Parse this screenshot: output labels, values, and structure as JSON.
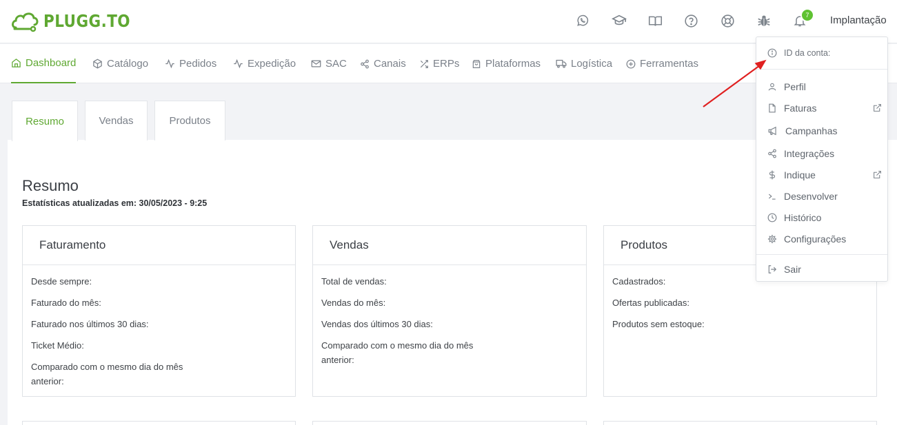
{
  "brand": {
    "name": "PLUGG.TO"
  },
  "header": {
    "icons": [
      "whatsapp-icon",
      "graduation-cap-icon",
      "book-icon",
      "help-circle-icon",
      "lifebuoy-icon",
      "bug-icon",
      "bell-icon"
    ],
    "notification_count": "7",
    "user_name": "Implantação"
  },
  "nav": {
    "items": [
      {
        "label": "Dashboard",
        "icon": "home-icon",
        "active": true
      },
      {
        "label": "Catálogo",
        "icon": "box-icon"
      },
      {
        "label": "Pedidos",
        "icon": "activity-icon"
      },
      {
        "label": "Expedição",
        "icon": "activity-icon"
      },
      {
        "label": "SAC",
        "icon": "mail-icon"
      },
      {
        "label": "Canais",
        "icon": "share-icon"
      },
      {
        "label": "ERPs",
        "icon": "shuffle-icon"
      },
      {
        "label": "Plataformas",
        "icon": "shopping-bag-icon"
      },
      {
        "label": "Logística",
        "icon": "truck-icon"
      },
      {
        "label": "Ferramentas",
        "icon": "plus-circle-icon"
      }
    ]
  },
  "tabs": [
    {
      "label": "Resumo",
      "active": true
    },
    {
      "label": "Vendas"
    },
    {
      "label": "Produtos"
    }
  ],
  "summary": {
    "title": "Resumo",
    "updated": "Estatísticas atualizadas em: 30/05/2023 - 9:25"
  },
  "cards": [
    {
      "title": "Faturamento",
      "rows": [
        "Desde sempre:",
        "Faturado do mês:",
        "Faturado nos últimos 30 dias:",
        "Ticket Médio:",
        "Comparado com o mesmo dia do mês anterior:"
      ]
    },
    {
      "title": "Vendas",
      "rows": [
        "Total de vendas:",
        "Vendas do mês:",
        "Vendas dos últimos 30 dias:",
        "Comparado com o mesmo dia do mês anterior:"
      ]
    },
    {
      "title": "Produtos",
      "rows": [
        "Cadastrados:",
        "Ofertas publicadas:",
        "Produtos sem estoque:"
      ]
    }
  ],
  "dropdown": {
    "account_id_label": "ID da conta:",
    "items": [
      {
        "label": "Perfil",
        "icon": "user-icon"
      },
      {
        "label": "Faturas",
        "icon": "file-icon",
        "external": true
      },
      {
        "label": "Campanhas",
        "icon": "megaphone-icon"
      },
      {
        "label": "Integrações",
        "icon": "share-icon"
      },
      {
        "label": "Indique",
        "icon": "dollar-icon",
        "external": true
      },
      {
        "label": "Desenvolver",
        "icon": "terminal-icon"
      },
      {
        "label": "Histórico",
        "icon": "clock-icon"
      },
      {
        "label": "Configurações",
        "icon": "settings-icon"
      }
    ],
    "logout_label": "Sair"
  },
  "colors": {
    "accent": "#5fa832",
    "badge": "#5fc232",
    "annotation_arrow": "#e02020"
  }
}
